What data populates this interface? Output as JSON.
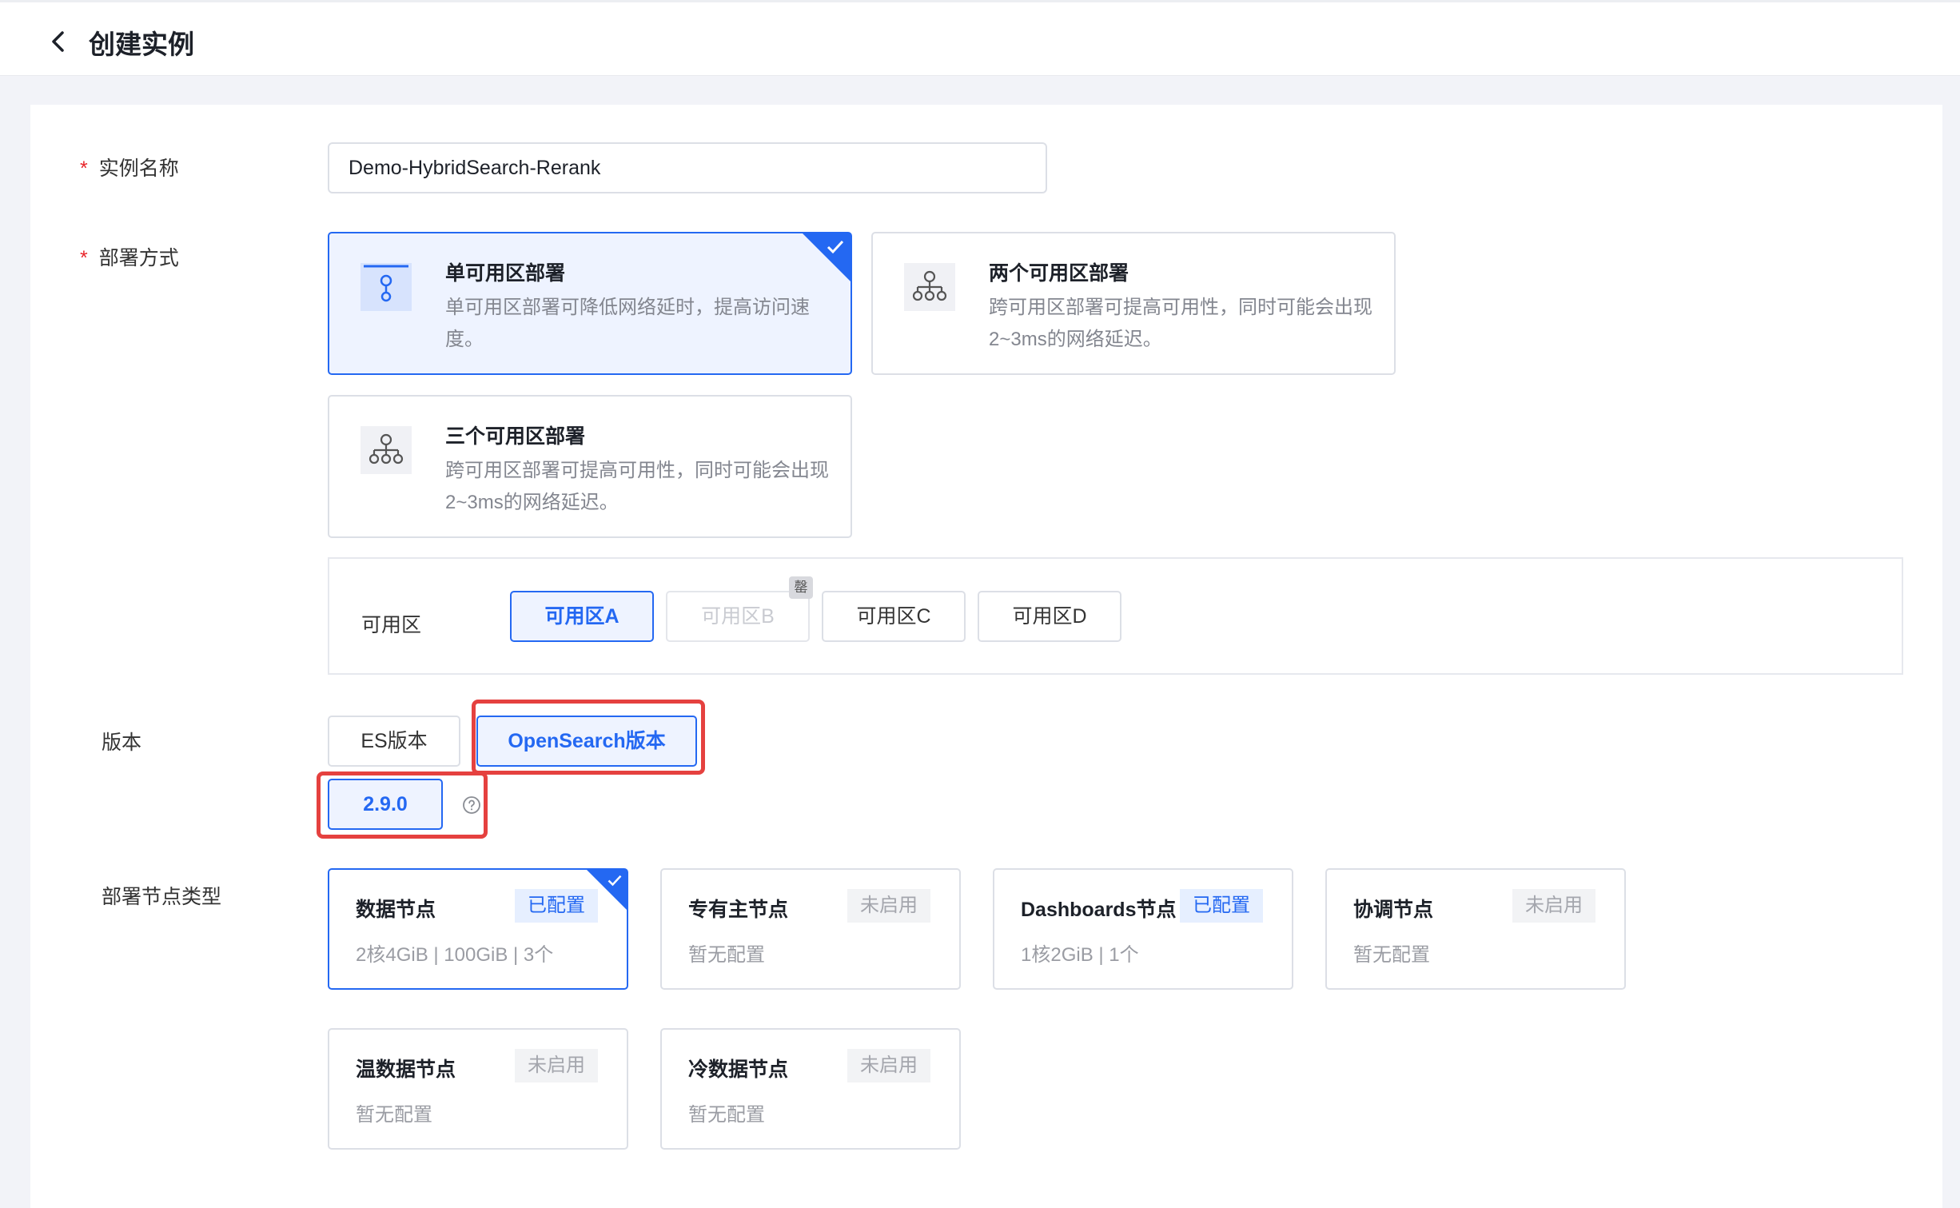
{
  "header": {
    "title": "创建实例"
  },
  "form": {
    "instance_name": {
      "label": "实例名称",
      "value": "Demo-HybridSearch-Rerank"
    },
    "deploy": {
      "label": "部署方式",
      "options": [
        {
          "title": "单可用区部署",
          "desc": "单可用区部署可降低网络延时，提高访问速度。",
          "selected": true
        },
        {
          "title": "两个可用区部署",
          "desc": "跨可用区部署可提高可用性，同时可能会出现2~3ms的网络延迟。",
          "selected": false
        },
        {
          "title": "三个可用区部署",
          "desc": "跨可用区部署可提高可用性，同时可能会出现2~3ms的网络延迟。",
          "selected": false
        }
      ]
    },
    "zone": {
      "label": "可用区",
      "options": [
        "可用区A",
        "可用区B",
        "可用区C",
        "可用区D"
      ],
      "selected": "可用区A",
      "disabled": [
        "可用区B"
      ],
      "badge": "罄"
    },
    "version": {
      "label": "版本",
      "types": [
        "ES版本",
        "OpenSearch版本"
      ],
      "selected_type": "OpenSearch版本",
      "versions": [
        "2.9.0"
      ],
      "selected_version": "2.9.0"
    },
    "node_types": {
      "label": "部署节点类型",
      "items": [
        {
          "name": "数据节点",
          "status": "已配置",
          "desc": "2核4GiB | 100GiB | 3个",
          "selected": true
        },
        {
          "name": "专有主节点",
          "status": "未启用",
          "desc": "暂无配置",
          "selected": false
        },
        {
          "name": "Dashboards节点",
          "status": "已配置",
          "desc": "1核2GiB | 1个",
          "selected": false
        },
        {
          "name": "协调节点",
          "status": "未启用",
          "desc": "暂无配置",
          "selected": false
        },
        {
          "name": "温数据节点",
          "status": "未启用",
          "desc": "暂无配置",
          "selected": false
        },
        {
          "name": "冷数据节点",
          "status": "未启用",
          "desc": "暂无配置",
          "selected": false
        }
      ]
    }
  },
  "colors": {
    "accent": "#2468f2",
    "highlight": "#e5413f",
    "required": "#e8252a"
  }
}
